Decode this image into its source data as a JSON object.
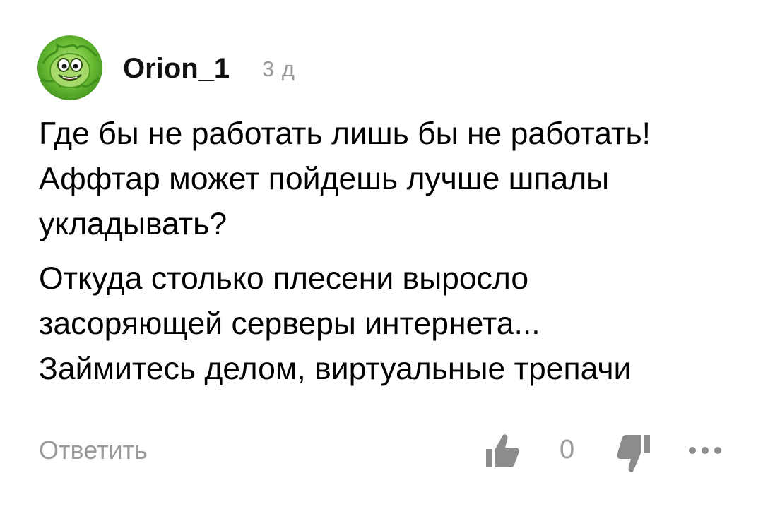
{
  "comment": {
    "author": "Orion_1",
    "timestamp": "3 д",
    "paragraphs": [
      "Где бы не работать лишь бы не работать!\nАффтар может пойдешь лучше шпалы\nукладывать?",
      "Откуда столько плесени выросло\nзасоряющей серверы интернета...\nЗаймитесь делом, виртуальные трепачи"
    ]
  },
  "actions": {
    "reply_label": "Ответить",
    "like_icon": "thumbs-up-icon",
    "like_count": "0",
    "dislike_icon": "thumbs-down-icon",
    "more_icon": "more-dots-icon"
  },
  "colors": {
    "text": "#000000",
    "muted": "#999999",
    "icon": "#8c8c8c",
    "avatar_green": "#5fae2b"
  }
}
